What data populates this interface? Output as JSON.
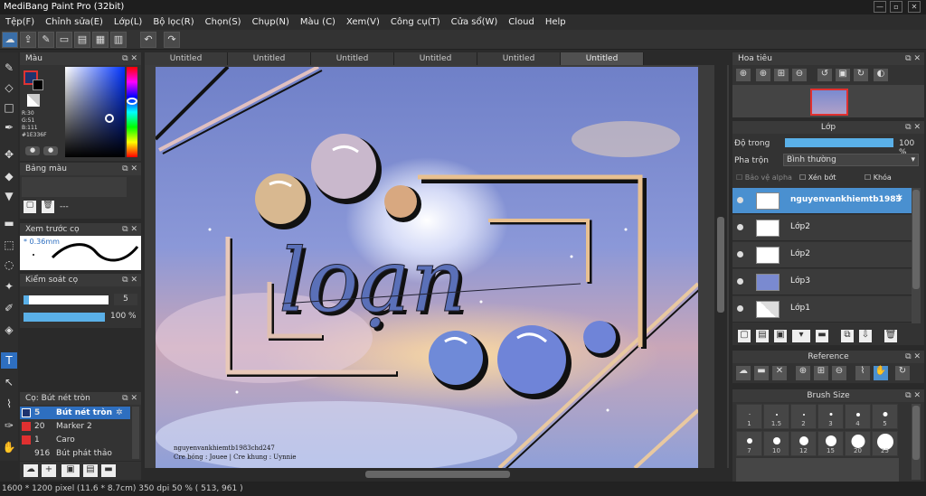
{
  "app": {
    "title": "MediBang Paint Pro (32bit)"
  },
  "menu": [
    "Tệp(F)",
    "Chỉnh sửa(E)",
    "Lớp(L)",
    "Bộ lọc(R)",
    "Chọn(S)",
    "Chụp(N)",
    "Màu (C)",
    "Xem(V)",
    "Công cụ(T)",
    "Cửa sổ(W)",
    "Cloud",
    "Help"
  ],
  "tabs": [
    "Untitled",
    "Untitled",
    "Untitled",
    "Untitled",
    "Untitled",
    "Untitled"
  ],
  "color_panel": {
    "title": "Màu",
    "r": "R:30",
    "g": "G:51",
    "b": "B:111",
    "hex": "#1E336F",
    "main_color": "#1e336f"
  },
  "palette_panel": {
    "title": "Bảng màu",
    "value": "---"
  },
  "brush_preview": {
    "title": "Xem trước cọ",
    "size": "0.36mm"
  },
  "brush_control": {
    "title": "Kiểm soát cọ",
    "size": "5",
    "opacity": "100 %"
  },
  "brush_list": {
    "title": "Cọ: Bút nét tròn",
    "items": [
      {
        "num": "5",
        "name": "Bút nét tròn",
        "color": "#1e336f"
      },
      {
        "num": "20",
        "name": "Marker 2",
        "color": "#e03030"
      },
      {
        "num": "1",
        "name": "Caro",
        "color": "#e03030"
      },
      {
        "num": "916",
        "name": "Bút phát thảo",
        "color": "#333333"
      }
    ]
  },
  "navigator": {
    "title": "Hoa tiêu"
  },
  "layers": {
    "title": "Lớp",
    "opacity_label": "Độ trong",
    "opacity_value": "100 %",
    "blend_label": "Pha trộn",
    "blend_value": "Bình thường",
    "protect_alpha": "Bảo vệ alpha",
    "clipping": "Xén bớt",
    "lock": "Khóa",
    "items": [
      {
        "name": "nguyenvankhiemtb1983"
      },
      {
        "name": "Lớp2"
      },
      {
        "name": "Lớp2"
      },
      {
        "name": "Lớp3"
      },
      {
        "name": "Lớp1"
      }
    ]
  },
  "reference": {
    "title": "Reference"
  },
  "brush_size": {
    "title": "Brush Size",
    "sizes": [
      "1",
      "1.5",
      "2",
      "3",
      "4",
      "5",
      "7",
      "10",
      "12",
      "15",
      "20",
      "25"
    ]
  },
  "artwork": {
    "lettering": "loạn",
    "credit1": "nguyenvankhiemtb1983chd247",
    "credit2": "Cre bóng : Jouee | Cre khung : Uynnie"
  },
  "status": {
    "text": "1600 * 1200 pixel   (11.6 * 8.7cm)   350 dpi   50 %   ( 513, 961 )"
  }
}
